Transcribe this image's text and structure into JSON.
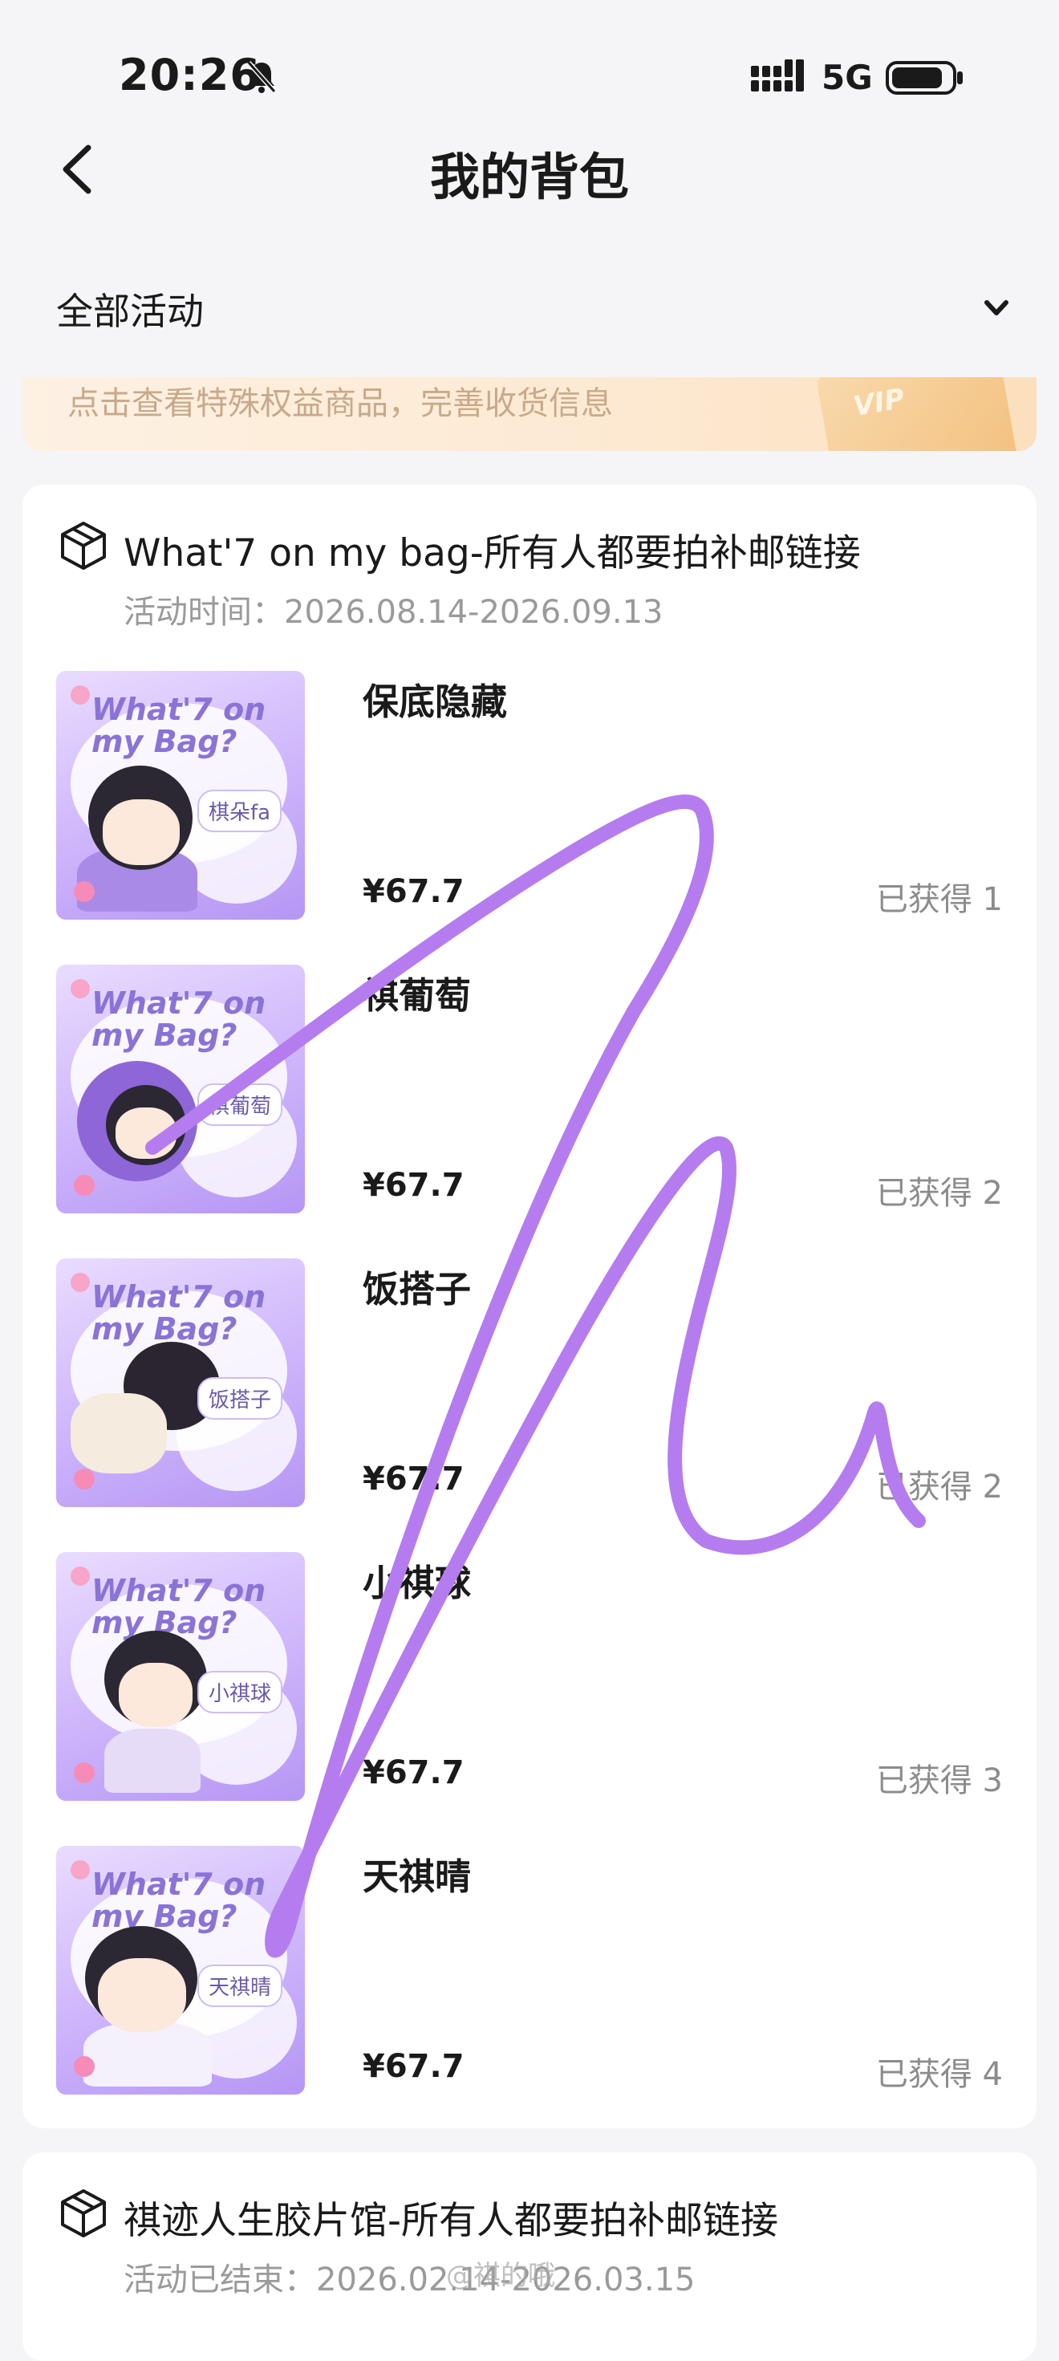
{
  "status": {
    "time": "20:26",
    "network": "5G"
  },
  "nav": {
    "title": "我的背包"
  },
  "filter": {
    "label": "全部活动"
  },
  "banner": {
    "text": "点击查看特殊权益商品，完善收货信息",
    "card_label": "VIP"
  },
  "activities": [
    {
      "title": "What'7 on my bag-所有人都要拍补邮链接",
      "time": "活动时间：2026.08.14-2026.09.13",
      "items": [
        {
          "name": "保底隐藏",
          "price": "¥67.7",
          "owned": "已获得 1",
          "thumb_logo": "What'7 on my Bag?",
          "thumb_tag": "棋朵fa"
        },
        {
          "name": "祺葡萄",
          "price": "¥67.7",
          "owned": "已获得 2",
          "thumb_logo": "What'7 on my Bag?",
          "thumb_tag": "祺葡萄"
        },
        {
          "name": "饭搭子",
          "price": "¥67.7",
          "owned": "已获得 2",
          "thumb_logo": "What'7 on my Bag?",
          "thumb_tag": "饭搭子"
        },
        {
          "name": "小祺球",
          "price": "¥67.7",
          "owned": "已获得 3",
          "thumb_logo": "What'7 on my Bag?",
          "thumb_tag": "小祺球"
        },
        {
          "name": "天祺晴",
          "price": "¥67.7",
          "owned": "已获得 4",
          "thumb_logo": "What'7 on my Bag?",
          "thumb_tag": "天祺晴"
        }
      ]
    },
    {
      "title": "祺迹人生胶片馆-所有人都要拍补邮链接",
      "time": "活动已结束：2026.02.14-2026.03.15"
    }
  ],
  "watermark": "@祺的哦",
  "colors": {
    "scribble": "#b57cf0",
    "thumb_bg": "#cdb4fb"
  }
}
